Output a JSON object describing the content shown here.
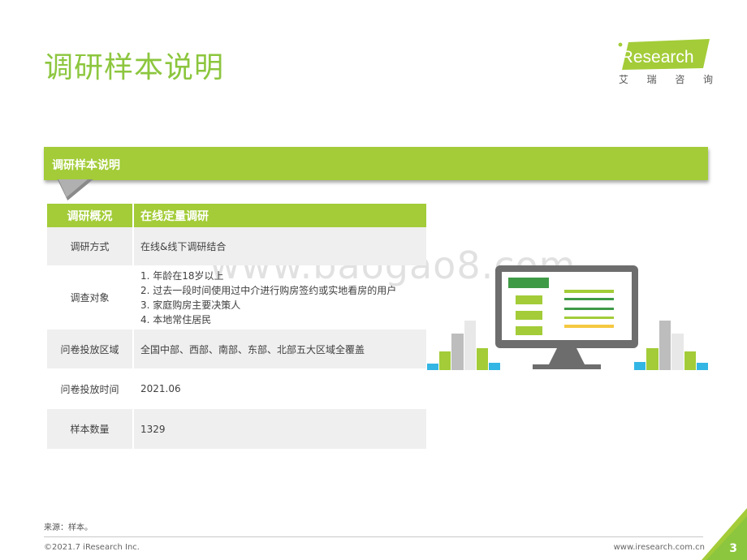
{
  "page": {
    "title": "调研样本说明",
    "page_number": "3",
    "watermark": "www.baogao8.com"
  },
  "logo": {
    "brand": "iResearch",
    "subtitle_chars": [
      "艾",
      "瑞",
      "咨",
      "询"
    ]
  },
  "banner": {
    "label": "调研样本说明"
  },
  "table": {
    "headers": [
      "调研概况",
      "在线定量调研"
    ],
    "rows": [
      {
        "label": "调研方式",
        "value": "在线&线下调研结合"
      },
      {
        "label": "调查对象",
        "items": [
          "1. 年龄在18岁以上",
          "2. 过去一段时间使用过中介进行购房签约或实地看房的用户",
          "3. 家庭购房主要决策人",
          "4. 本地常住居民"
        ]
      },
      {
        "label": "问卷投放区域",
        "value": "全国中部、西部、南部、东部、北部五大区域全覆盖"
      },
      {
        "label": "问卷投放时间",
        "value": "2021.06"
      },
      {
        "label": "样本数量",
        "value": "1329"
      }
    ]
  },
  "footer": {
    "source": "来源：样本。",
    "copyright": "©2021.7 iResearch Inc.",
    "url": "www.iresearch.com.cn"
  },
  "colors": {
    "accent_green": "#a3cc38",
    "title_green": "#8cc63e",
    "monitor_gray": "#6d6d6d",
    "bar_yellow": "#f5c842",
    "bar_blue": "#34b6e4"
  },
  "icons": [
    "monitor-icon",
    "bar-chart-icon"
  ]
}
